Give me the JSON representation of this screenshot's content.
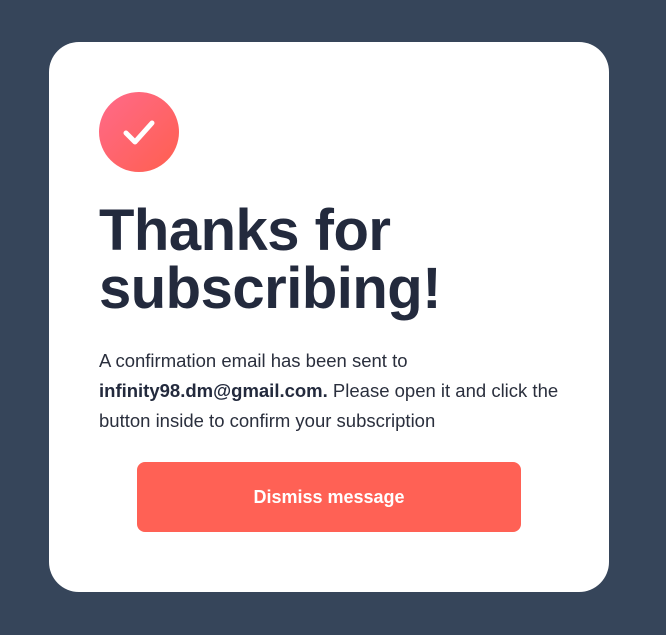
{
  "card": {
    "icon": "checkmark-icon",
    "title_line1": "Thanks for",
    "title_line2": "subscribing!",
    "message_before": "A confirmation email has been sent to ",
    "email": "infinity98.dm@gmail.com.",
    "message_after": " Please open it and click the button inside to confirm your subscription",
    "dismiss_label": "Dismiss message"
  },
  "colors": {
    "background": "#36455a",
    "card": "#ffffff",
    "title": "#232a3d",
    "accent": "#ff6155",
    "badge_gradient_start": "#ff6a8a",
    "badge_gradient_end": "#ff5f4f"
  }
}
